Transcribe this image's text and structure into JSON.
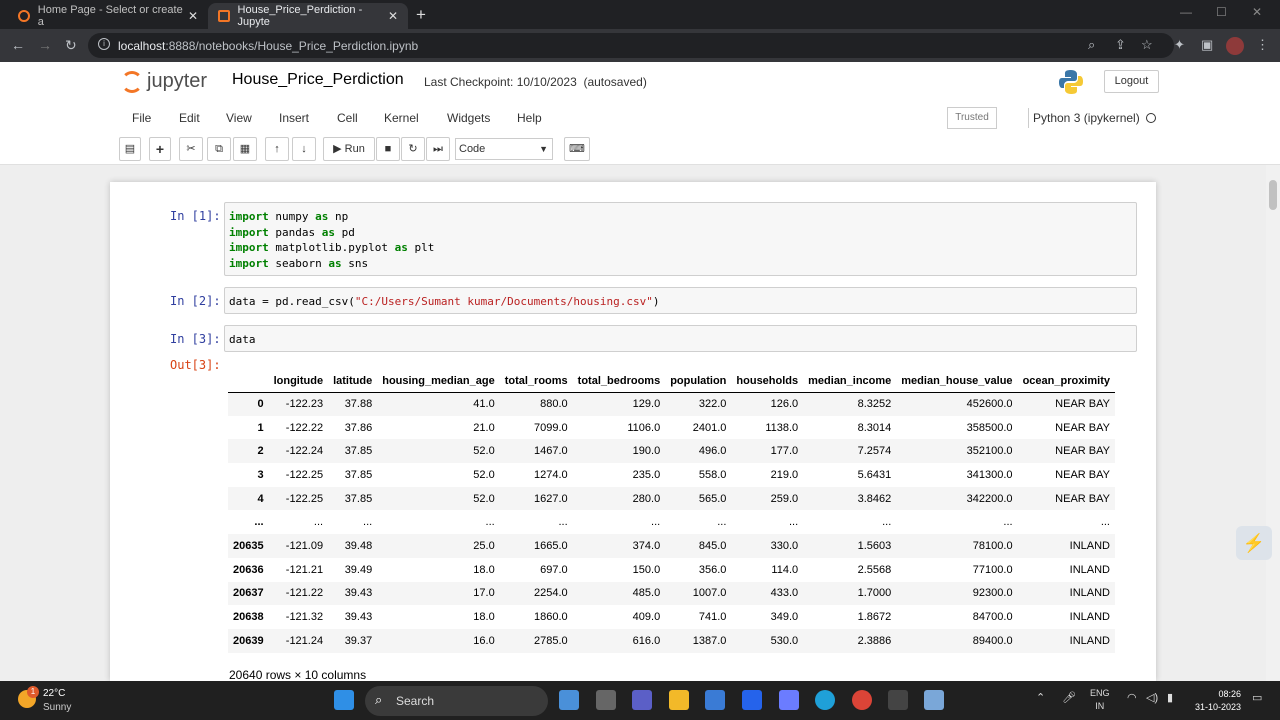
{
  "browser": {
    "tabs": [
      {
        "title": "Home Page - Select or create a",
        "active": false
      },
      {
        "title": "House_Price_Perdiction - Jupyte",
        "active": true
      }
    ],
    "url_host": "localhost",
    "url_path": ":8888/notebooks/House_Price_Perdiction.ipynb"
  },
  "jupyter": {
    "logo_text": "jupyter",
    "notebook_name": "House_Price_Perdiction",
    "checkpoint": "Last Checkpoint: 10/10/2023",
    "save_status": "(autosaved)",
    "logout_label": "Logout",
    "menus": [
      "File",
      "Edit",
      "View",
      "Insert",
      "Cell",
      "Kernel",
      "Widgets",
      "Help"
    ],
    "trusted_label": "Trusted",
    "kernel_name": "Python 3 (ipykernel)",
    "run_label": "Run",
    "cell_type": "Code"
  },
  "cells": [
    {
      "prompt": "In [1]:",
      "lines": [
        "import numpy as np",
        "import pandas as pd",
        "import matplotlib.pyplot as plt",
        "import seaborn as sns"
      ]
    },
    {
      "prompt": "In [2]:",
      "lines": [
        "data = pd.read_csv(\"C:/Users/Sumant kumar/Documents/housing.csv\")"
      ]
    },
    {
      "prompt": "In [3]:",
      "lines": [
        "data"
      ]
    }
  ],
  "output": {
    "prompt": "Out[3]:",
    "columns": [
      "",
      "longitude",
      "latitude",
      "housing_median_age",
      "total_rooms",
      "total_bedrooms",
      "population",
      "households",
      "median_income",
      "median_house_value",
      "ocean_proximity"
    ],
    "rows": [
      [
        "0",
        "-122.23",
        "37.88",
        "41.0",
        "880.0",
        "129.0",
        "322.0",
        "126.0",
        "8.3252",
        "452600.0",
        "NEAR BAY"
      ],
      [
        "1",
        "-122.22",
        "37.86",
        "21.0",
        "7099.0",
        "1106.0",
        "2401.0",
        "1138.0",
        "8.3014",
        "358500.0",
        "NEAR BAY"
      ],
      [
        "2",
        "-122.24",
        "37.85",
        "52.0",
        "1467.0",
        "190.0",
        "496.0",
        "177.0",
        "7.2574",
        "352100.0",
        "NEAR BAY"
      ],
      [
        "3",
        "-122.25",
        "37.85",
        "52.0",
        "1274.0",
        "235.0",
        "558.0",
        "219.0",
        "5.6431",
        "341300.0",
        "NEAR BAY"
      ],
      [
        "4",
        "-122.25",
        "37.85",
        "52.0",
        "1627.0",
        "280.0",
        "565.0",
        "259.0",
        "3.8462",
        "342200.0",
        "NEAR BAY"
      ],
      [
        "...",
        "...",
        "...",
        "...",
        "...",
        "...",
        "...",
        "...",
        "...",
        "...",
        "..."
      ],
      [
        "20635",
        "-121.09",
        "39.48",
        "25.0",
        "1665.0",
        "374.0",
        "845.0",
        "330.0",
        "1.5603",
        "78100.0",
        "INLAND"
      ],
      [
        "20636",
        "-121.21",
        "39.49",
        "18.0",
        "697.0",
        "150.0",
        "356.0",
        "114.0",
        "2.5568",
        "77100.0",
        "INLAND"
      ],
      [
        "20637",
        "-121.22",
        "39.43",
        "17.0",
        "2254.0",
        "485.0",
        "1007.0",
        "433.0",
        "1.7000",
        "92300.0",
        "INLAND"
      ],
      [
        "20638",
        "-121.32",
        "39.43",
        "18.0",
        "1860.0",
        "409.0",
        "741.0",
        "349.0",
        "1.8672",
        "84700.0",
        "INLAND"
      ],
      [
        "20639",
        "-121.24",
        "39.37",
        "16.0",
        "2785.0",
        "616.0",
        "1387.0",
        "530.0",
        "2.3886",
        "89400.0",
        "INLAND"
      ]
    ],
    "shape_text": "20640 rows × 10 columns"
  },
  "taskbar": {
    "temperature": "22°C",
    "weather": "Sunny",
    "weather_badge": "1",
    "search_label": "Search",
    "lang": "ENG",
    "region": "IN",
    "time": "08:26",
    "date": "31-10-2023"
  },
  "colors": {
    "jupyter_orange": "#f37626",
    "in_prompt": "#303f9f",
    "out_prompt": "#d84315"
  }
}
